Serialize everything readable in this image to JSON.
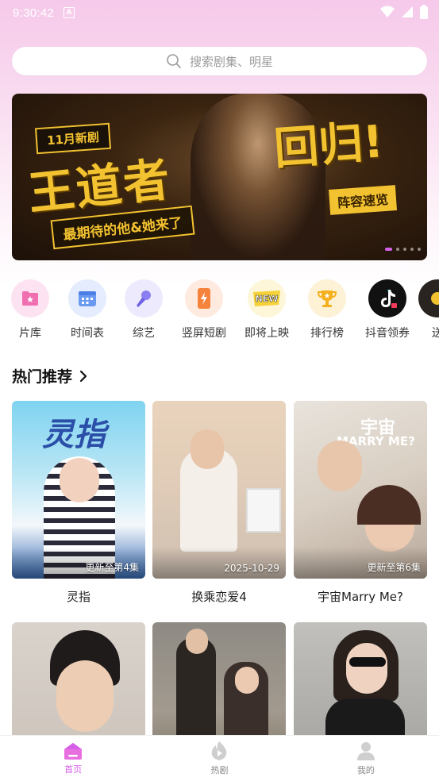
{
  "status_bar": {
    "time": "9:30:42",
    "notification_glyph": "A"
  },
  "search": {
    "placeholder": "搜索剧集、明星"
  },
  "banner": {
    "tag": "11月新剧",
    "title_left": "王道者",
    "title_right": "回归!",
    "subtitle_left": "最期待的他&她来了",
    "subtitle_right": "阵容速览",
    "page_count": 5,
    "active_page": 1
  },
  "categories": [
    {
      "label": "片库",
      "icon": "film-library-icon"
    },
    {
      "label": "时间表",
      "icon": "calendar-icon"
    },
    {
      "label": "综艺",
      "icon": "microphone-icon"
    },
    {
      "label": "竖屏短剧",
      "icon": "lightning-phone-icon"
    },
    {
      "label": "即将上映",
      "icon": "new-badge-icon"
    },
    {
      "label": "排行榜",
      "icon": "trophy-icon"
    },
    {
      "label": "抖音领券",
      "icon": "tiktok-icon"
    },
    {
      "label": "送",
      "icon": "gift-icon"
    }
  ],
  "hot": {
    "title": "热门推荐",
    "items": [
      {
        "title": "灵指",
        "badge": "更新至第4集",
        "poster_text": "灵指"
      },
      {
        "title": "换乘恋爱4",
        "badge": "2025-10-29",
        "poster_text": ""
      },
      {
        "title": "宇宙Marry Me?",
        "badge": "更新至第6集",
        "poster_text": "宇宙",
        "poster_subtext": "MARRY ME?"
      },
      {
        "title": "",
        "badge": "",
        "poster_text": ""
      },
      {
        "title": "",
        "badge": "",
        "poster_text": ""
      },
      {
        "title": "",
        "badge": "",
        "poster_text": ""
      }
    ]
  },
  "tabbar": {
    "items": [
      {
        "label": "首页",
        "icon": "home-icon",
        "active": true
      },
      {
        "label": "热剧",
        "icon": "play-fire-icon",
        "active": false
      },
      {
        "label": "我的",
        "icon": "user-icon",
        "active": false
      }
    ]
  },
  "colors": {
    "accent": "#d65fe8",
    "banner_gold": "#f2c230"
  }
}
